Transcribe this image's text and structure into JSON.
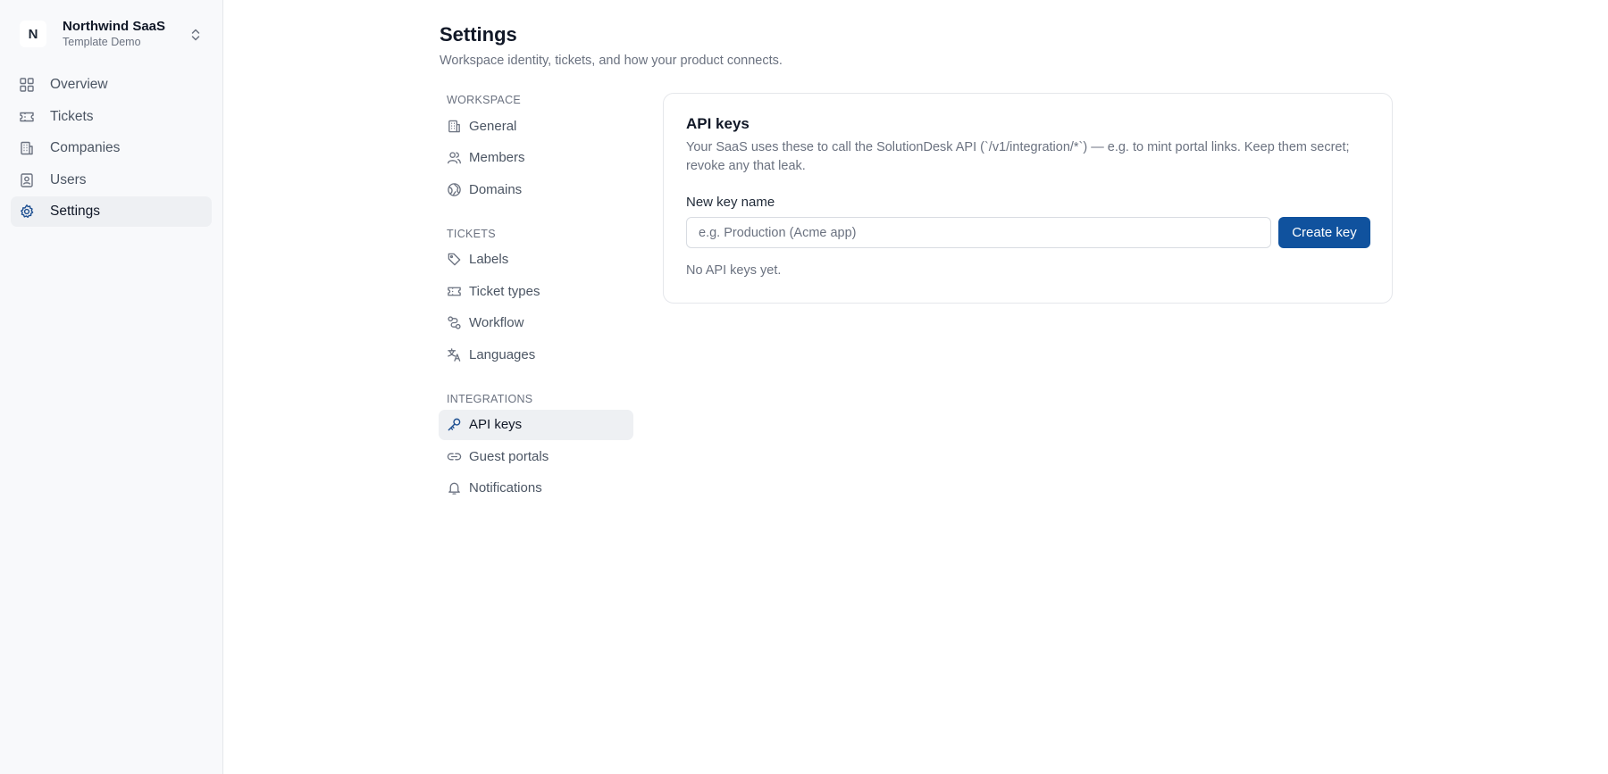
{
  "workspace": {
    "avatar_letter": "N",
    "name": "Northwind SaaS",
    "subtitle": "Template Demo"
  },
  "sidebar": {
    "items": [
      {
        "label": "Overview",
        "icon": "grid-icon",
        "active": false
      },
      {
        "label": "Tickets",
        "icon": "ticket-icon",
        "active": false
      },
      {
        "label": "Companies",
        "icon": "building-icon",
        "active": false
      },
      {
        "label": "Users",
        "icon": "contact-icon",
        "active": false
      },
      {
        "label": "Settings",
        "icon": "gear-icon",
        "active": true
      }
    ]
  },
  "page": {
    "title": "Settings",
    "subtitle": "Workspace identity, tickets, and how your product connects."
  },
  "settings_nav": {
    "workspace": {
      "label": "WORKSPACE",
      "items": [
        {
          "label": "General",
          "icon": "building-icon"
        },
        {
          "label": "Members",
          "icon": "users-icon"
        },
        {
          "label": "Domains",
          "icon": "globe-icon"
        }
      ]
    },
    "tickets": {
      "label": "TICKETS",
      "items": [
        {
          "label": "Labels",
          "icon": "tag-icon"
        },
        {
          "label": "Ticket types",
          "icon": "ticket-icon"
        },
        {
          "label": "Workflow",
          "icon": "workflow-icon"
        },
        {
          "label": "Languages",
          "icon": "languages-icon"
        }
      ]
    },
    "integrations": {
      "label": "INTEGRATIONS",
      "items": [
        {
          "label": "API keys",
          "icon": "key-icon",
          "active": true
        },
        {
          "label": "Guest portals",
          "icon": "link-icon"
        },
        {
          "label": "Notifications",
          "icon": "bell-icon"
        }
      ]
    }
  },
  "api_keys": {
    "title": "API keys",
    "description": "Your SaaS uses these to call the SolutionDesk API (`/v1/integration/*`) — e.g. to mint portal links. Keep them secret; revoke any that leak.",
    "field_label": "New key name",
    "input_value": "",
    "input_placeholder": "e.g. Production (Acme app)",
    "create_button": "Create key",
    "empty_state": "No API keys yet."
  },
  "colors": {
    "accent": "#10529e",
    "sidebar_bg": "#f8f9fb",
    "active_bg": "#eef0f3"
  }
}
